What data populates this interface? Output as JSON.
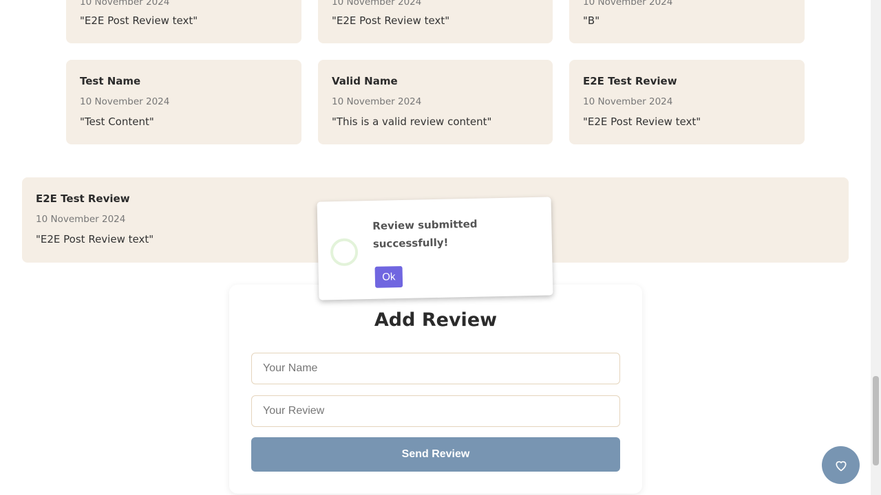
{
  "reviews": [
    {
      "name": "",
      "date": "10 November 2024",
      "text": "\"E2E Post Review text\""
    },
    {
      "name": "",
      "date": "10 November 2024",
      "text": "\"E2E Post Review text\""
    },
    {
      "name": "",
      "date": "10 November 2024",
      "text": "\"B\""
    },
    {
      "name": "Test Name",
      "date": "10 November 2024",
      "text": "\"Test Content\""
    },
    {
      "name": "Valid Name",
      "date": "10 November 2024",
      "text": "\"This is a valid review content\""
    },
    {
      "name": "E2E Test Review",
      "date": "10 November 2024",
      "text": "\"E2E Post Review text\""
    },
    {
      "name": "E2E Test Review",
      "date": "10 November 2024",
      "text": "\"E2E Post Review text\""
    }
  ],
  "popup": {
    "message": "Review submitted successfully!",
    "ok_label": "Ok",
    "icon": "success-ring-icon"
  },
  "form": {
    "title": "Add Review",
    "name_placeholder": "Your Name",
    "review_placeholder": "Your Review",
    "send_label": "Send Review"
  },
  "fab": {
    "icon": "heart-icon"
  },
  "colors": {
    "card": "#f5eee5",
    "accent": "#7895b2",
    "ok_button": "#7066e0"
  }
}
